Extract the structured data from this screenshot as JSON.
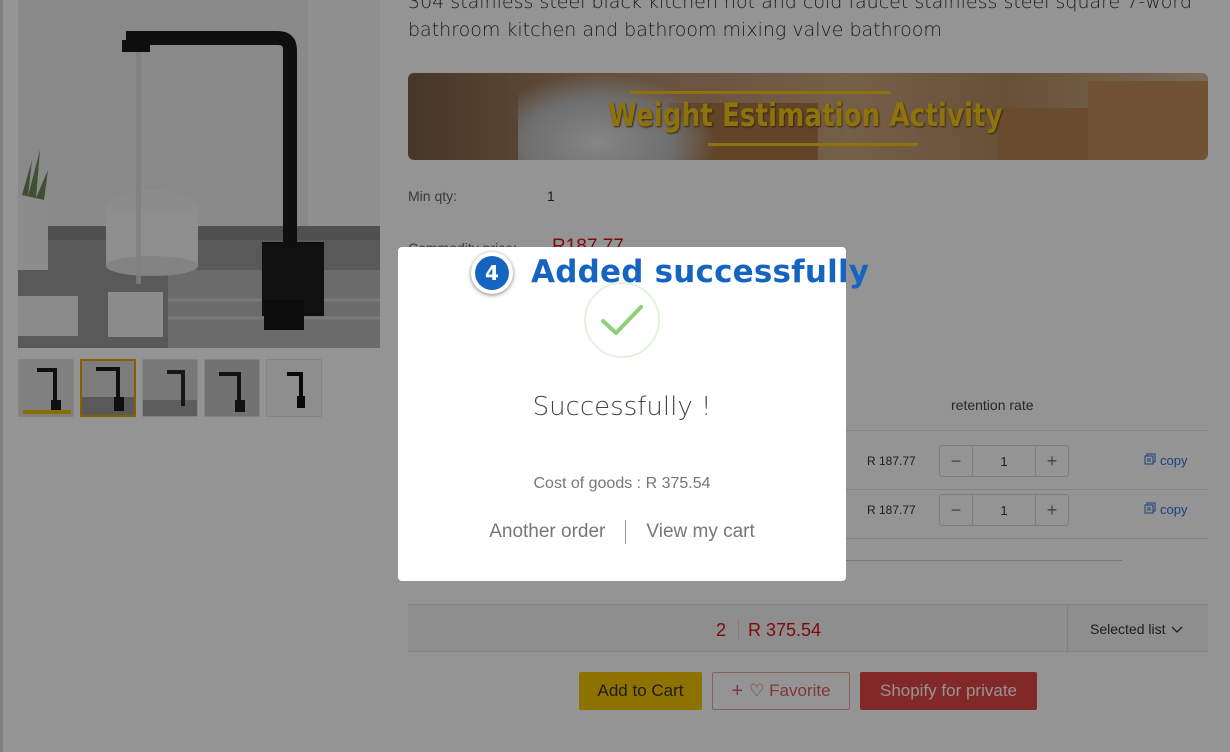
{
  "product": {
    "title": "304 stainless steel black kitchen hot and cold faucet stainless steel square 7-word bathroom kitchen and bathroom mixing valve bathroom",
    "banner_text": "Weight Estimation Activity",
    "min_qty_label": "Min qty:",
    "min_qty_value": "1",
    "commodity_price_label": "Commodity price:",
    "commodity_price_value": "R187.77"
  },
  "table": {
    "retention_rate_header": "retention rate",
    "rows": [
      {
        "price": "R 187.77",
        "qty": "1",
        "minus": "−",
        "plus": "+",
        "copy": "copy"
      },
      {
        "price": "R 187.77",
        "qty": "1",
        "minus": "−",
        "plus": "+",
        "copy": "copy"
      }
    ]
  },
  "summary": {
    "count": "2",
    "total": "R 375.54",
    "selected_list": "Selected list"
  },
  "actions": {
    "add_to_cart": "Add to Cart",
    "favorite": "♡ Favorite",
    "favorite_plus": "+",
    "shopify": "Shopify for private"
  },
  "modal": {
    "title": "Successfully !",
    "cost": "Cost of goods : R 375.54",
    "another_order": "Another order",
    "view_cart": "View my cart"
  },
  "annotation": {
    "step": "4",
    "caption": "Added successfully"
  },
  "colors": {
    "accent_blue": "#1565c0",
    "price_red": "#dd1111",
    "cart_yellow": "#f5c400",
    "shopify_red": "#e04545"
  }
}
